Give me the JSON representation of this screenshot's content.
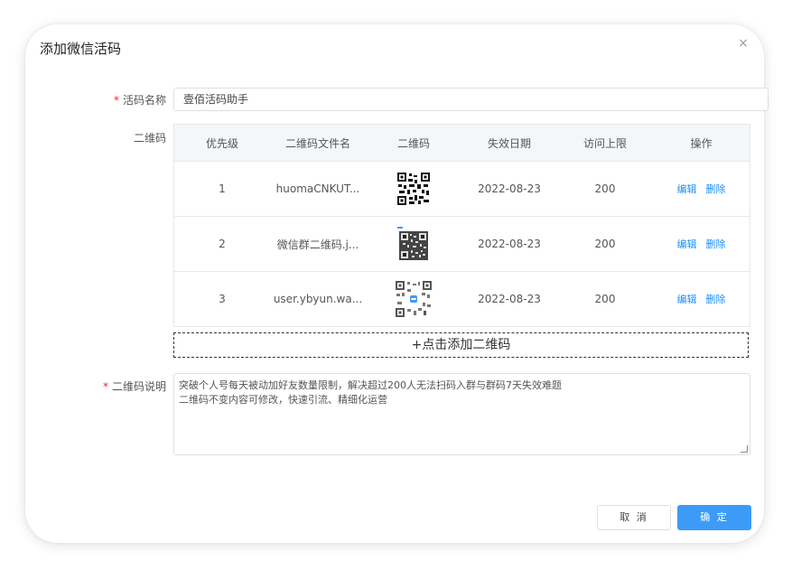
{
  "dialog": {
    "title": "添加微信活码",
    "close_symbol": "×"
  },
  "form": {
    "name_label": "活码名称",
    "name_value": "壹佰活码助手",
    "qr_label": "二维码",
    "desc_label": "二维码说明",
    "desc_line1": "突破个人号每天被动加好友数量限制，解决超过200人无法扫码入群与群码7天失效难题",
    "desc_line2": "二维码不变内容可修改，快速引流、精细化运营",
    "add_qr_label": "+点击添加二维码"
  },
  "table": {
    "headers": [
      "优先级",
      "二维码文件名",
      "二维码",
      "失效日期",
      "访问上限",
      "操作"
    ],
    "rows": [
      {
        "priority": "1",
        "filename": "huomaCNKUT...",
        "qr_icon": "qr-code-image",
        "expire": "2022-08-23",
        "limit": "200",
        "edit": "编辑",
        "delete": "删除"
      },
      {
        "priority": "2",
        "filename": "微信群二维码.j...",
        "qr_icon": "qr-code-image",
        "expire": "2022-08-23",
        "limit": "200",
        "edit": "编辑",
        "delete": "删除"
      },
      {
        "priority": "3",
        "filename": "user.ybyun.wa...",
        "qr_icon": "qr-code-image",
        "expire": "2022-08-23",
        "limit": "200",
        "edit": "编辑",
        "delete": "删除"
      }
    ]
  },
  "footer": {
    "cancel_label": "取 消",
    "ok_label": "确 定"
  },
  "colors": {
    "primary": "#3d9bf8",
    "link": "#1890ff",
    "required": "#f5222d"
  }
}
